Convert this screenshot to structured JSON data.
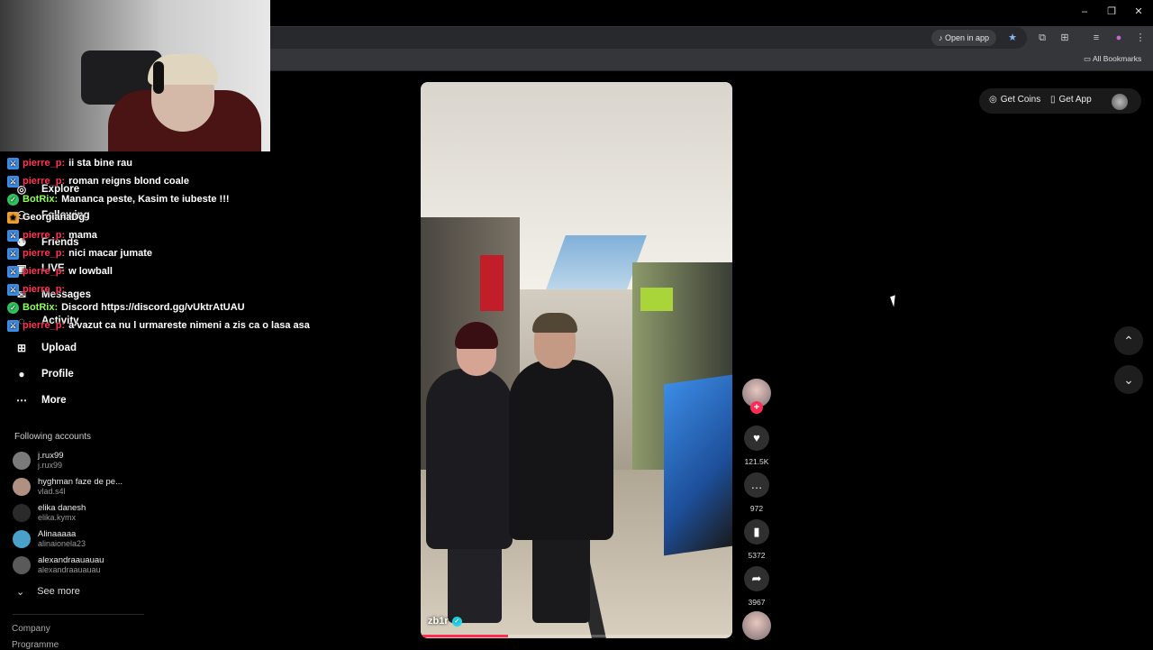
{
  "browser": {
    "open_in_app": "Open in app",
    "all_bookmarks": "All Bookmarks",
    "window_controls": [
      "–",
      "❐",
      "✕"
    ]
  },
  "header": {
    "get_coins": "Get Coins",
    "get_app": "Get App"
  },
  "sidebar": {
    "nav": [
      {
        "label": "Explore",
        "icon": "compass-icon"
      },
      {
        "label": "Following",
        "icon": "following-icon"
      },
      {
        "label": "Friends",
        "icon": "friends-icon"
      },
      {
        "label": "LIVE",
        "icon": "live-icon"
      },
      {
        "label": "Messages",
        "icon": "messages-icon"
      },
      {
        "label": "Activity",
        "icon": "activity-icon"
      },
      {
        "label": "Upload",
        "icon": "upload-icon"
      },
      {
        "label": "Profile",
        "icon": "profile-icon"
      },
      {
        "label": "More",
        "icon": "more-icon"
      }
    ],
    "following_title": "Following accounts",
    "accounts": [
      {
        "name": "j.rux99",
        "handle": "j.rux99",
        "color": "#7a7a7a"
      },
      {
        "name": "hyghman faze de pe...",
        "handle": "vlad.s4l",
        "color": "#b09080"
      },
      {
        "name": "elika danesh",
        "handle": "elika.kymx",
        "color": "#2a2a2a"
      },
      {
        "name": "Alinaaaaa",
        "handle": "alinaionela23",
        "color": "#4aa0c8"
      },
      {
        "name": "alexandraauauau",
        "handle": "alexandraauauau",
        "color": "#5a5a5a"
      }
    ],
    "see_more": "See more",
    "company": "Company",
    "programme": "Programme"
  },
  "chat": [
    {
      "user": "pierre_p:",
      "user_color": "red",
      "badge": "blue",
      "message": "ii sta bine rau"
    },
    {
      "user": "pierre_p:",
      "user_color": "red",
      "badge": "blue",
      "message": "roman reigns blond coale"
    },
    {
      "user": "BotRix:",
      "user_color": "green",
      "badge": "green",
      "message": "Mananca peste, Kasim te iubeste !!!"
    },
    {
      "user": "GeorgianaDg",
      "user_color": "white",
      "badge": "orange",
      "message": ""
    },
    {
      "user": "pierre_p:",
      "user_color": "red",
      "badge": "blue",
      "message": "mama"
    },
    {
      "user": "pierre_p:",
      "user_color": "red",
      "badge": "blue",
      "message": "nici macar jumate"
    },
    {
      "user": "pierre_p:",
      "user_color": "red",
      "badge": "blue",
      "message": "w lowball"
    },
    {
      "user": "pierre_p:",
      "user_color": "red",
      "badge": "blue",
      "message": ""
    },
    {
      "user": "BotRix:",
      "user_color": "green",
      "badge": "green",
      "message": "Discord https://discord.gg/vUktrAtUAU"
    },
    {
      "user": "pierre_p:",
      "user_color": "red",
      "badge": "blue",
      "message": "a vazut ca nu l urmareste nimeni a zis ca o lasa asa"
    }
  ],
  "video": {
    "author": "zb1r",
    "progress": 0.28,
    "likes": "121.5K",
    "comments": "972",
    "saves": "5372",
    "shares": "3967"
  },
  "colors": {
    "accent": "#fe2c55",
    "verified": "#20d5ec"
  }
}
